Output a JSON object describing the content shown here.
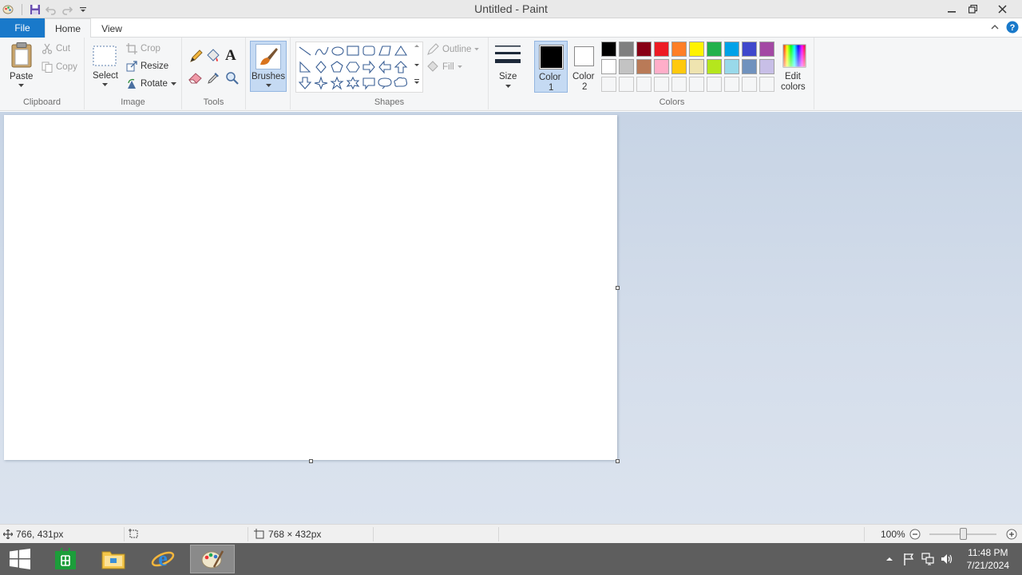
{
  "window": {
    "title": "Untitled - Paint"
  },
  "tabs": {
    "file": "File",
    "home": "Home",
    "view": "View"
  },
  "ribbon": {
    "clipboard": {
      "group_label": "Clipboard",
      "paste": "Paste",
      "cut": "Cut",
      "copy": "Copy"
    },
    "image": {
      "group_label": "Image",
      "select": "Select",
      "crop": "Crop",
      "resize": "Resize",
      "rotate": "Rotate"
    },
    "tools": {
      "group_label": "Tools",
      "text_glyph": "A"
    },
    "brushes": {
      "label": "Brushes"
    },
    "shapes": {
      "group_label": "Shapes",
      "outline": "Outline",
      "fill": "Fill",
      "icons": [
        "line-icon",
        "curve-icon",
        "oval-icon",
        "rectangle-icon",
        "rounded-rectangle-icon",
        "polygon-icon",
        "triangle-icon",
        "right-triangle-icon",
        "diamond-icon",
        "pentagon-icon",
        "hexagon-icon",
        "right-arrow-icon",
        "left-arrow-icon",
        "up-arrow-icon",
        "down-arrow-icon",
        "four-point-star-icon",
        "five-point-star-icon",
        "six-point-star-icon",
        "rounded-callout-icon",
        "oval-callout-icon",
        "cloud-callout-icon"
      ]
    },
    "size": {
      "label": "Size"
    },
    "colors": {
      "group_label": "Colors",
      "color1_line1": "Color",
      "color1_line2": "1",
      "color2_line1": "Color",
      "color2_line2": "2",
      "edit_line1": "Edit",
      "edit_line2": "colors",
      "color1_value": "#000000",
      "color2_value": "#ffffff",
      "palette_row1": [
        "#000000",
        "#7f7f7f",
        "#880015",
        "#ed1c24",
        "#ff7f27",
        "#fff200",
        "#22b14c",
        "#00a2e8",
        "#3f48cc",
        "#a349a4"
      ],
      "palette_row2": [
        "#ffffff",
        "#c3c3c3",
        "#b97a57",
        "#ffaec9",
        "#ffc90e",
        "#efe4b0",
        "#b5e61d",
        "#99d9ea",
        "#7092be",
        "#c8bfe7"
      ]
    }
  },
  "canvas": {
    "background": "#ffffff"
  },
  "status": {
    "cursor_pos": "766, 431px",
    "canvas_size": "768 × 432px",
    "zoom": "100%"
  },
  "taskbar": {
    "time": "11:48 PM",
    "date": "7/21/2024"
  },
  "accent": "#1979ca"
}
